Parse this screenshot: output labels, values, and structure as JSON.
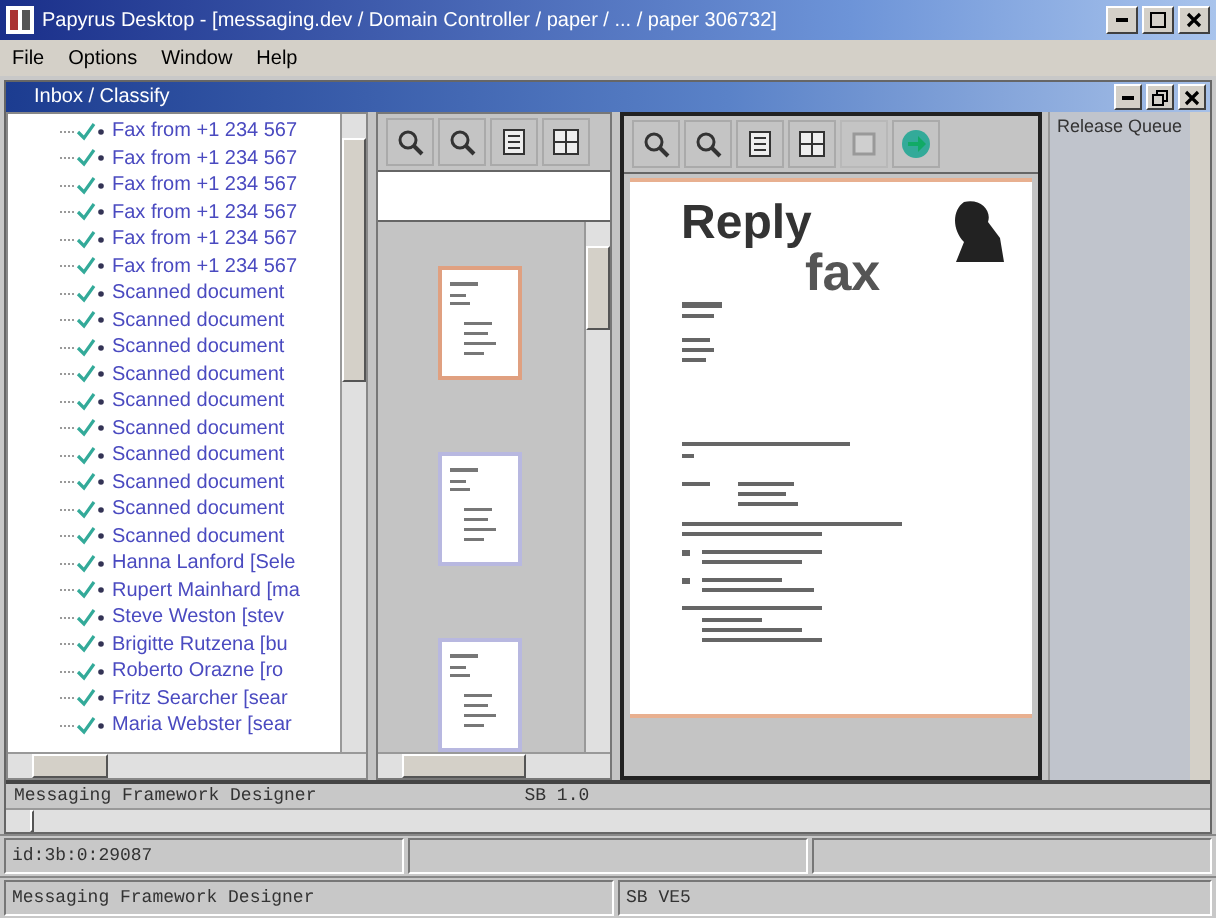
{
  "window": {
    "title": "Papyrus Desktop - [messaging.dev / Domain Controller / paper / ... / paper 306732]"
  },
  "menu": [
    "File",
    "Options",
    "Window",
    "Help"
  ],
  "child_window": {
    "title": "Inbox / Classify"
  },
  "tree": {
    "items": [
      {
        "label": "Fax from +1 234 567"
      },
      {
        "label": "Fax from +1 234 567"
      },
      {
        "label": "Fax from +1 234 567"
      },
      {
        "label": "Fax from +1 234 567"
      },
      {
        "label": "Fax from +1 234 567"
      },
      {
        "label": "Fax from +1 234 567"
      },
      {
        "label": "Scanned document"
      },
      {
        "label": "Scanned document"
      },
      {
        "label": "Scanned document"
      },
      {
        "label": "Scanned document"
      },
      {
        "label": "Scanned document"
      },
      {
        "label": "Scanned document"
      },
      {
        "label": "Scanned document"
      },
      {
        "label": "Scanned document"
      },
      {
        "label": "Scanned document"
      },
      {
        "label": "Scanned document"
      },
      {
        "label": "Hanna Lanford [Sele"
      },
      {
        "label": "Rupert Mainhard [ma"
      },
      {
        "label": "Steve Weston [stev"
      },
      {
        "label": "Brigitte Rutzena [bu"
      },
      {
        "label": "Roberto Orazne [ro"
      },
      {
        "label": "Fritz Searcher [sear"
      },
      {
        "label": "Maria Webster [sear"
      }
    ]
  },
  "thumbnails": {
    "toolbar": [
      {
        "kind": "zoom-in"
      },
      {
        "kind": "zoom-out"
      },
      {
        "kind": "page"
      },
      {
        "kind": "grid"
      }
    ],
    "pages": [
      {
        "selected": true
      },
      {
        "selected": false
      },
      {
        "selected": false
      }
    ]
  },
  "viewer": {
    "toolbar": [
      {
        "kind": "zoom-in",
        "disabled": false
      },
      {
        "kind": "zoom-out",
        "disabled": false
      },
      {
        "kind": "page",
        "disabled": false
      },
      {
        "kind": "grid",
        "disabled": false
      },
      {
        "kind": "blank",
        "disabled": true
      },
      {
        "kind": "next",
        "disabled": false
      }
    ],
    "document": {
      "heading_1": "Reply",
      "heading_2": "fax"
    }
  },
  "release_queue": {
    "title": "Release Queue"
  },
  "output_line": {
    "left": "Messaging Framework Designer",
    "right": "SB 1.0"
  },
  "status_bar": {
    "row_1": [
      "id:3b:0:29087"
    ],
    "row_2": [
      "Messaging Framework Designer",
      "SB VE5"
    ]
  }
}
